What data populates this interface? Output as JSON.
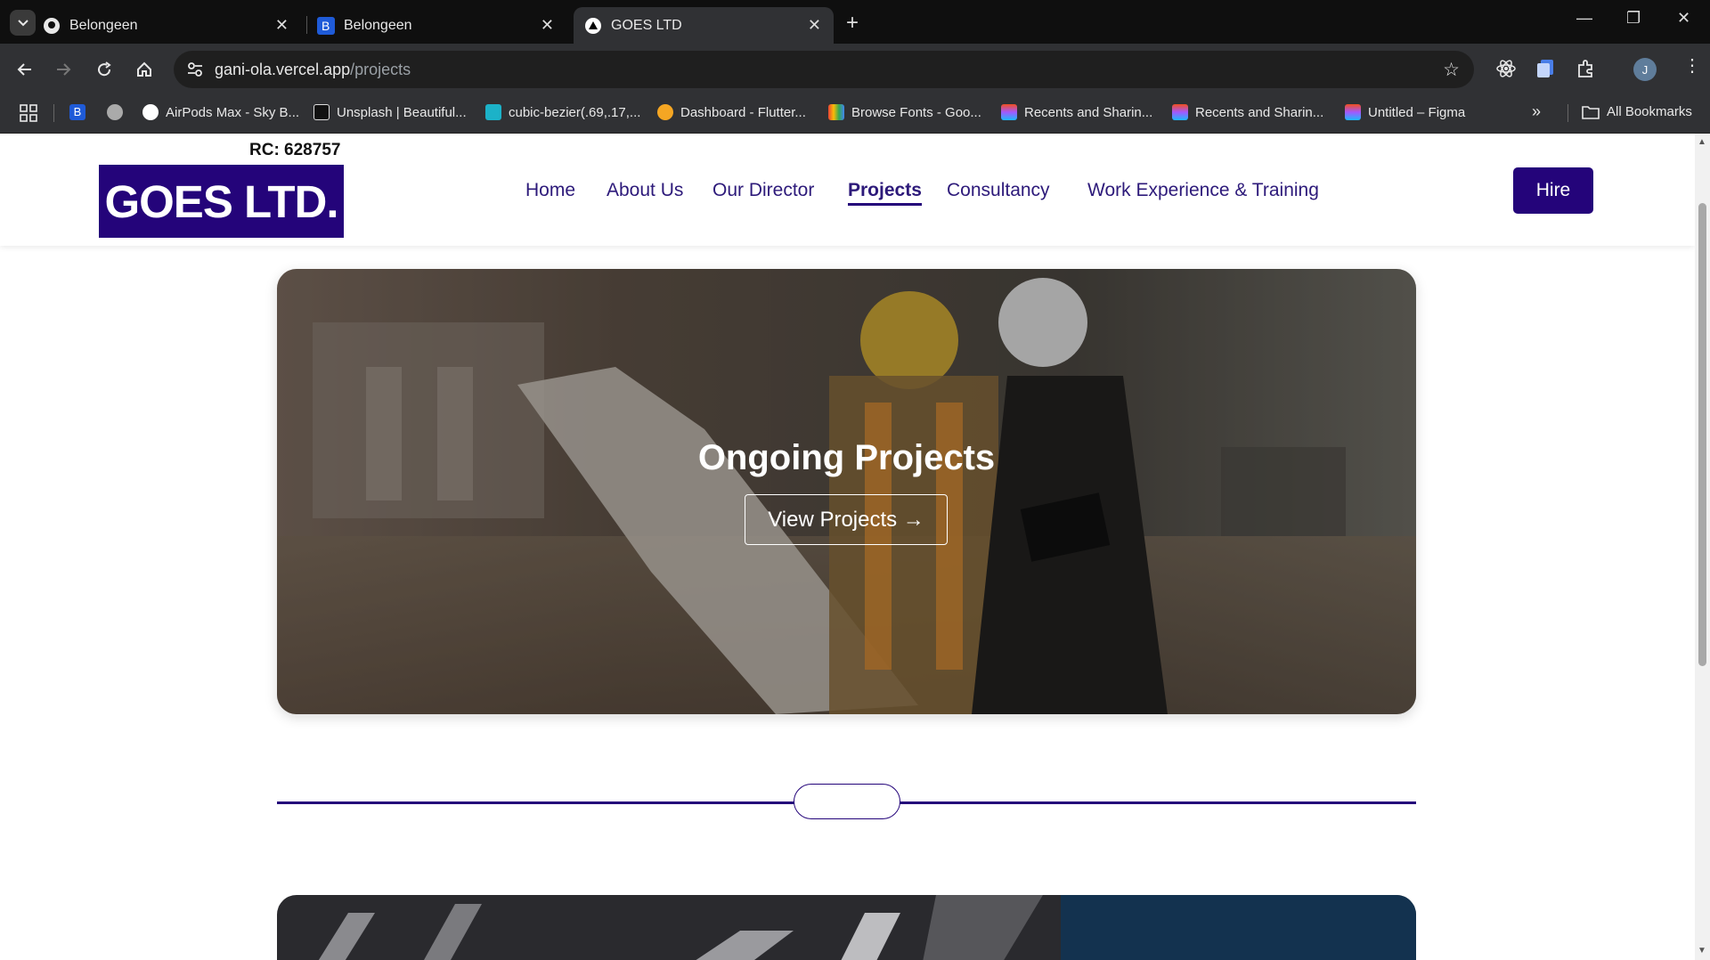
{
  "browser": {
    "tabs": [
      {
        "title": "Belongeen",
        "icon": "github-icon"
      },
      {
        "title": "Belongeen",
        "icon": "b-icon"
      },
      {
        "title": "GOES LTD",
        "icon": "vercel-icon",
        "active": true
      }
    ],
    "url_host": "gani-ola.vercel.app",
    "url_path": "/projects",
    "bookmarks": [
      {
        "label": "AirPods Max - Sky B..."
      },
      {
        "label": "Unsplash | Beautiful..."
      },
      {
        "label": "cubic-bezier(.69,.17,..."
      },
      {
        "label": "Dashboard - Flutter..."
      },
      {
        "label": "Browse Fonts - Goo..."
      },
      {
        "label": "Recents and Sharin..."
      },
      {
        "label": "Recents and Sharin..."
      },
      {
        "label": "Untitled – Figma"
      }
    ],
    "all_bookmarks": "All Bookmarks",
    "avatar_letter": "J",
    "overflow": "»"
  },
  "site": {
    "rc": "RC: 628757",
    "logo": "GOES LTD.",
    "nav": [
      "Home",
      "About Us",
      "Our Director",
      "Projects",
      "Consultancy",
      "Work Experience & Training"
    ],
    "active_nav": "Projects",
    "hire": "Hire",
    "brand_color": "#24047a"
  },
  "hero": {
    "title": "Ongoing Projects",
    "button": "View Projects →"
  }
}
